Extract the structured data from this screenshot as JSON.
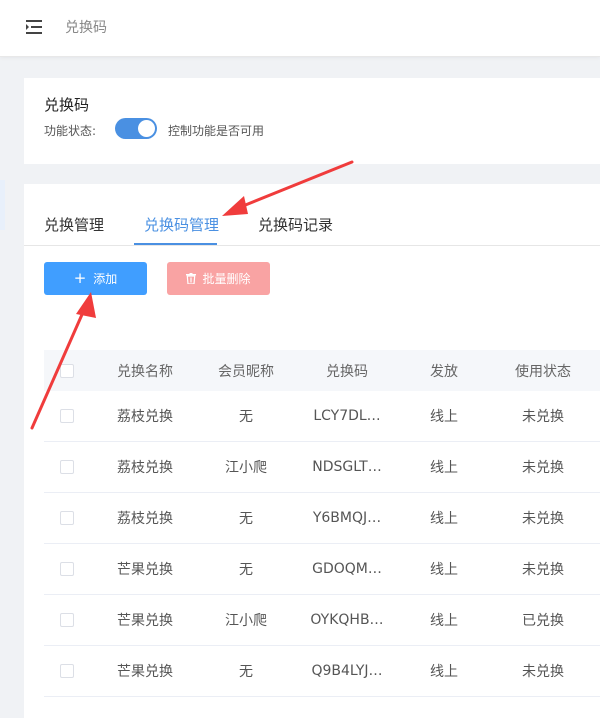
{
  "header": {
    "title": "兑换码"
  },
  "settings_card": {
    "title": "兑换码",
    "status_label": "功能状态:",
    "switch_on": true,
    "switch_description": "控制功能是否可用"
  },
  "tabs": [
    {
      "label": "兑换管理",
      "active": false
    },
    {
      "label": "兑换码管理",
      "active": true
    },
    {
      "label": "兑换码记录",
      "active": false
    }
  ],
  "toolbar": {
    "add_label": "添加",
    "batch_delete_label": "批量删除"
  },
  "table": {
    "columns": [
      "兑换名称",
      "会员昵称",
      "兑换码",
      "发放",
      "使用状态"
    ],
    "rows": [
      {
        "name": "荔枝兑换",
        "nickname": "无",
        "code": "LCY7DL…",
        "issue": "线上",
        "status": "未兑换"
      },
      {
        "name": "荔枝兑换",
        "nickname": "江小爬",
        "code": "NDSGLT…",
        "issue": "线上",
        "status": "未兑换"
      },
      {
        "name": "荔枝兑换",
        "nickname": "无",
        "code": "Y6BMQJ…",
        "issue": "线上",
        "status": "未兑换"
      },
      {
        "name": "芒果兑换",
        "nickname": "无",
        "code": "GDOQM…",
        "issue": "线上",
        "status": "未兑换"
      },
      {
        "name": "芒果兑换",
        "nickname": "江小爬",
        "code": "OYKQHB…",
        "issue": "线上",
        "status": "已兑换"
      },
      {
        "name": "芒果兑换",
        "nickname": "无",
        "code": "Q9B4LYJ…",
        "issue": "线上",
        "status": "未兑换"
      }
    ]
  },
  "colors": {
    "primary": "#409eff",
    "active_tab": "#4a90e2",
    "danger_disabled": "#f9a3a3",
    "annotation": "#f03c3c"
  },
  "icons": {
    "menu": "menu-fold-icon",
    "add": "plus-icon",
    "delete": "trash-icon"
  }
}
